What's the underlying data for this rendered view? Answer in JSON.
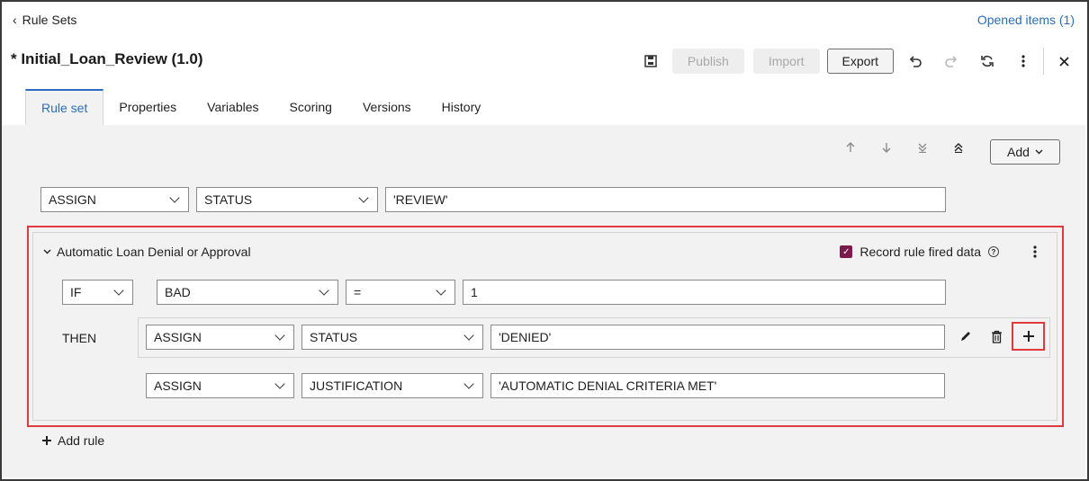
{
  "header": {
    "back_label": "Rule Sets",
    "opened_items": "Opened items (1)",
    "title": "* Initial_Loan_Review (1.0)"
  },
  "toolbar": {
    "save_icon": "save-icon",
    "publish": "Publish",
    "import": "Import",
    "export": "Export",
    "undo_icon": "undo-icon",
    "redo_icon": "redo-icon",
    "refresh_icon": "refresh-icon",
    "more_icon": "more-icon",
    "close_icon": "close-icon"
  },
  "tabs": [
    {
      "label": "Rule set",
      "active": true
    },
    {
      "label": "Properties"
    },
    {
      "label": "Variables"
    },
    {
      "label": "Scoring"
    },
    {
      "label": "Versions"
    },
    {
      "label": "History"
    }
  ],
  "rowtools": {
    "add": "Add"
  },
  "top_assign": {
    "action": "ASSIGN",
    "variable": "STATUS",
    "value": "'REVIEW'"
  },
  "rule": {
    "name": "Automatic Loan Denial or Approval",
    "record_label": "Record rule fired data",
    "record_checked": true,
    "if_label": "IF",
    "if_var": "BAD",
    "if_op": "=",
    "if_value": "1",
    "then_label": "THEN",
    "actions": [
      {
        "action": "ASSIGN",
        "variable": "STATUS",
        "value": "'DENIED'"
      },
      {
        "action": "ASSIGN",
        "variable": "JUSTIFICATION",
        "value": "'AUTOMATIC DENIAL CRITERIA MET'"
      }
    ]
  },
  "add_rule": "Add rule",
  "colors": {
    "accent": "#2a6dbf",
    "highlight": "#e0393e",
    "checkbox": "#7c1a4d"
  }
}
